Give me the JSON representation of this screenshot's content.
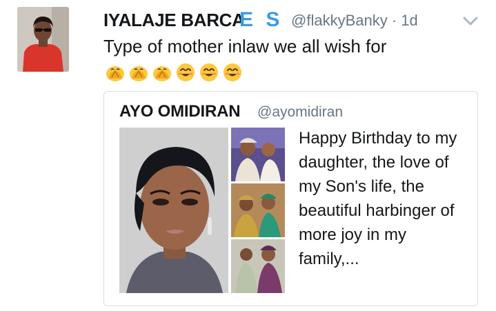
{
  "tweet": {
    "display_name": "IYALAJE BARCA",
    "badge": "E S",
    "handle": "@flakkyBanky",
    "time": "· 1d",
    "text": "Type of mother inlaw we all wish for",
    "emojis": [
      "folded-hands-emoji",
      "folded-hands-emoji",
      "folded-hands-emoji",
      "smiling-face-emoji",
      "smiling-face-emoji",
      "smiling-face-emoji"
    ]
  },
  "quoted_tweet": {
    "display_name": "AYO OMIDIRAN",
    "handle": "@ayomidiran",
    "text": "Happy Birthday to my daughter, the love of my Son's life, the beautiful harbinger of more joy in my family,..."
  },
  "colors": {
    "handle": "#657786",
    "badge": "#3b9ae1",
    "card_border": "#d6dde3",
    "emoji": "#ffc83d"
  }
}
